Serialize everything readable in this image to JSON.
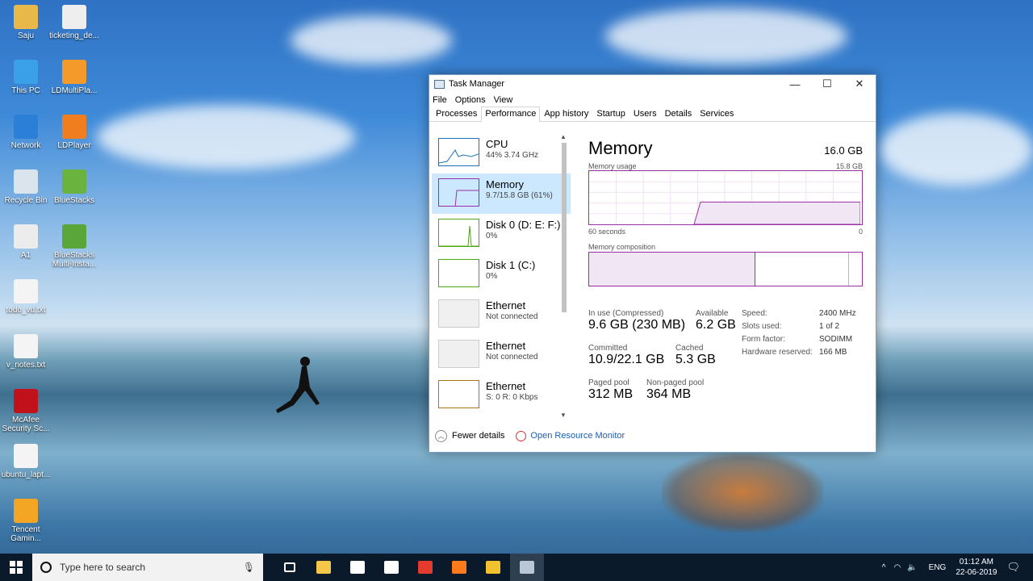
{
  "desktop": {
    "icons": [
      {
        "label": "Saju",
        "color": "#e8b84a"
      },
      {
        "label": "ticketing_de...",
        "color": "#eeeeee"
      },
      {
        "label": "This PC",
        "color": "#3aa0e8"
      },
      {
        "label": "LDMultiPla...",
        "color": "#f39a2b"
      },
      {
        "label": "Network",
        "color": "#2b7fd6"
      },
      {
        "label": "LDPlayer",
        "color": "#f07e1e"
      },
      {
        "label": "Recycle Bin",
        "color": "#d9e4ec"
      },
      {
        "label": "BlueStacks",
        "color": "#6bb33f"
      },
      {
        "label": "A1",
        "color": "#ececec"
      },
      {
        "label": "BlueStacks Multi-Insta...",
        "color": "#5aa63a"
      },
      {
        "label": "todo_vd.txt",
        "color": "#f4f4f4"
      },
      {
        "label": "v_notes.txt",
        "color": "#f4f4f4"
      },
      {
        "label": "McAfee Security Sc...",
        "color": "#c1121c"
      },
      {
        "label": "ubuntu_lapt...",
        "color": "#f4f4f4"
      },
      {
        "label": "Tencent Gamin...",
        "color": "#f2a623"
      }
    ]
  },
  "window": {
    "title": "Task Manager",
    "controls": {
      "minimize": "—",
      "maximize": "☐",
      "close": "✕"
    },
    "menu": [
      "File",
      "Options",
      "View"
    ],
    "tabs": [
      "Processes",
      "Performance",
      "App history",
      "Startup",
      "Users",
      "Details",
      "Services"
    ],
    "active_tab": "Performance",
    "resources": [
      {
        "name": "CPU",
        "detail": "44% 3.74 GHz",
        "color": "#1a73b8"
      },
      {
        "name": "Memory",
        "detail": "9.7/15.8 GB (61%)",
        "color": "#9b2ea6"
      },
      {
        "name": "Disk 0 (D: E: F:)",
        "detail": "0%",
        "color": "#4ca70f"
      },
      {
        "name": "Disk 1 (C:)",
        "detail": "0%",
        "color": "#4ca70f"
      },
      {
        "name": "Ethernet",
        "detail": "Not connected",
        "color": "#cccccc"
      },
      {
        "name": "Ethernet",
        "detail": "Not connected",
        "color": "#cccccc"
      },
      {
        "name": "Ethernet",
        "detail": "S: 0 R: 0 Kbps",
        "color": "#a7780e"
      }
    ],
    "memory": {
      "title": "Memory",
      "total": "16.0 GB",
      "usage_label": "Memory usage",
      "usage_max": "15.8 GB",
      "time_left": "60 seconds",
      "time_right": "0",
      "composition_label": "Memory composition",
      "usage_fraction": 0.61,
      "stats": {
        "in_use_label": "In use (Compressed)",
        "in_use": "9.6 GB (230 MB)",
        "available_label": "Available",
        "available": "6.2 GB",
        "committed_label": "Committed",
        "committed": "10.9/22.1 GB",
        "cached_label": "Cached",
        "cached": "5.3 GB",
        "paged_label": "Paged pool",
        "paged": "312 MB",
        "nonpaged_label": "Non-paged pool",
        "nonpaged": "364 MB"
      },
      "specs": [
        {
          "k": "Speed:",
          "v": "2400 MHz"
        },
        {
          "k": "Slots used:",
          "v": "1 of 2"
        },
        {
          "k": "Form factor:",
          "v": "SODIMM"
        },
        {
          "k": "Hardware reserved:",
          "v": "166 MB"
        }
      ]
    },
    "footer": {
      "fewer": "Fewer details",
      "resmon": "Open Resource Monitor"
    }
  },
  "taskbar": {
    "search_placeholder": "Type here to search",
    "lang": "ENG",
    "time": "01:12 AM",
    "date": "22-06-2019",
    "apps": [
      {
        "name": "task-view",
        "color": "#ffffff"
      },
      {
        "name": "file-explorer",
        "color": "#f4c64a"
      },
      {
        "name": "store",
        "color": "#ffffff"
      },
      {
        "name": "mail",
        "color": "#ffffff"
      },
      {
        "name": "opera",
        "color": "#e33b2e"
      },
      {
        "name": "firefox",
        "color": "#ff7a1a"
      },
      {
        "name": "game",
        "color": "#f2c12e"
      },
      {
        "name": "task-manager",
        "color": "#b9c7d6"
      }
    ]
  }
}
